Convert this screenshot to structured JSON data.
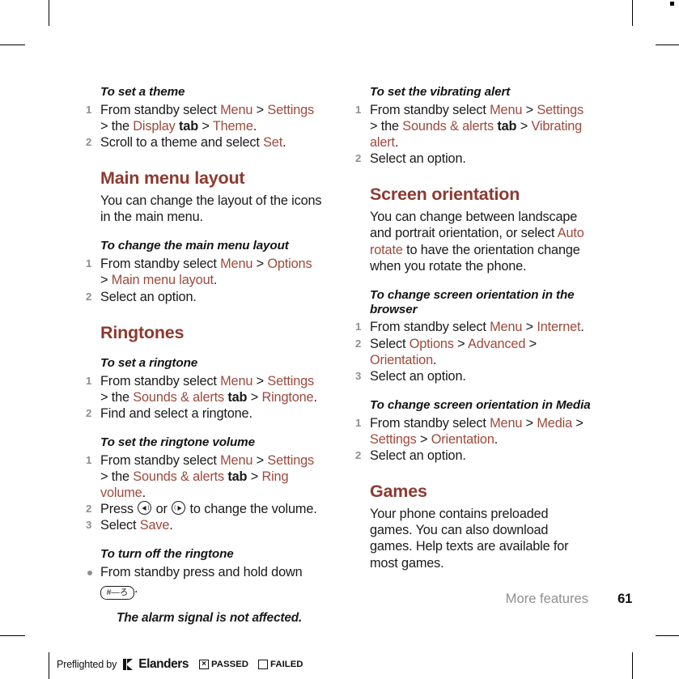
{
  "document": {
    "footer": {
      "section_name": "More features",
      "page_number": "61"
    },
    "preflight": {
      "label": "Preflighted by",
      "brand": "Elanders",
      "passed_label": "PASSED",
      "failed_label": "FAILED",
      "passed_checked": true,
      "failed_checked": false
    },
    "colors": {
      "heading": "#8c3a30",
      "link": "#9b4a3c",
      "body": "#1a1a1a",
      "muted": "#8e8e8e"
    }
  },
  "left_column": {
    "proc_theme": {
      "heading": "To set a theme",
      "steps": [
        {
          "num": "1",
          "parts": [
            {
              "t": "From standby select ",
              "k": "plain"
            },
            {
              "t": "Menu",
              "k": "link"
            },
            {
              "t": " > ",
              "k": "plain"
            },
            {
              "t": "Settings",
              "k": "link"
            },
            {
              "t": " > the ",
              "k": "plain"
            },
            {
              "t": "Display",
              "k": "link"
            },
            {
              "t": " tab",
              "k": "bold"
            },
            {
              "t": " > ",
              "k": "plain"
            },
            {
              "t": "Theme",
              "k": "link"
            },
            {
              "t": ".",
              "k": "plain"
            }
          ]
        },
        {
          "num": "2",
          "parts": [
            {
              "t": "Scroll to a theme and select ",
              "k": "plain"
            },
            {
              "t": "Set",
              "k": "link"
            },
            {
              "t": ".",
              "k": "plain"
            }
          ]
        }
      ]
    },
    "sec_main_menu_layout": {
      "title": "Main menu layout",
      "body": "You can change the layout of the icons in the main menu."
    },
    "proc_change_layout": {
      "heading": "To change the main menu layout",
      "steps": [
        {
          "num": "1",
          "parts": [
            {
              "t": "From standby select ",
              "k": "plain"
            },
            {
              "t": "Menu",
              "k": "link"
            },
            {
              "t": " > ",
              "k": "plain"
            },
            {
              "t": "Options",
              "k": "link"
            },
            {
              "t": " > ",
              "k": "plain"
            },
            {
              "t": "Main menu layout",
              "k": "link"
            },
            {
              "t": ".",
              "k": "plain"
            }
          ]
        },
        {
          "num": "2",
          "parts": [
            {
              "t": "Select an option.",
              "k": "plain"
            }
          ]
        }
      ]
    },
    "sec_ringtones": {
      "title": "Ringtones"
    },
    "proc_set_ringtone": {
      "heading": "To set a ringtone",
      "steps": [
        {
          "num": "1",
          "parts": [
            {
              "t": "From standby select ",
              "k": "plain"
            },
            {
              "t": "Menu",
              "k": "link"
            },
            {
              "t": " > ",
              "k": "plain"
            },
            {
              "t": "Settings",
              "k": "link"
            },
            {
              "t": " > the ",
              "k": "plain"
            },
            {
              "t": "Sounds & alerts",
              "k": "link"
            },
            {
              "t": " tab",
              "k": "bold"
            },
            {
              "t": " > ",
              "k": "plain"
            },
            {
              "t": "Ringtone",
              "k": "link"
            },
            {
              "t": ".",
              "k": "plain"
            }
          ]
        },
        {
          "num": "2",
          "parts": [
            {
              "t": "Find and select a ringtone.",
              "k": "plain"
            }
          ]
        }
      ]
    },
    "proc_ringtone_volume": {
      "heading": "To set the ringtone volume",
      "steps": [
        {
          "num": "1",
          "parts": [
            {
              "t": "From standby select ",
              "k": "plain"
            },
            {
              "t": "Menu",
              "k": "link"
            },
            {
              "t": " > ",
              "k": "plain"
            },
            {
              "t": "Settings",
              "k": "link"
            },
            {
              "t": " > the ",
              "k": "plain"
            },
            {
              "t": "Sounds & alerts",
              "k": "link"
            },
            {
              "t": " tab",
              "k": "bold"
            },
            {
              "t": " > ",
              "k": "plain"
            },
            {
              "t": "Ring volume",
              "k": "link"
            },
            {
              "t": ".",
              "k": "plain"
            }
          ]
        },
        {
          "num": "2",
          "press_prefix": "Press ",
          "press_middle": " or ",
          "press_suffix": " to change the volume.",
          "key_left_name": "volume-down-key",
          "key_right_name": "volume-up-key"
        },
        {
          "num": "3",
          "parts": [
            {
              "t": "Select ",
              "k": "plain"
            },
            {
              "t": "Save",
              "k": "link"
            },
            {
              "t": ".",
              "k": "plain"
            }
          ]
        }
      ]
    },
    "proc_turn_off_ringtone": {
      "heading": "To turn off the ringtone",
      "bullet_text": "From standby press and hold down ",
      "key_hash_label": "#—ろ",
      "bullet_suffix": "."
    },
    "note": {
      "text": "The alarm signal is not affected."
    }
  },
  "right_column": {
    "proc_vibrating_alert": {
      "heading": "To set the vibrating alert",
      "steps": [
        {
          "num": "1",
          "parts": [
            {
              "t": "From standby select ",
              "k": "plain"
            },
            {
              "t": "Menu",
              "k": "link"
            },
            {
              "t": " > ",
              "k": "plain"
            },
            {
              "t": "Settings",
              "k": "link"
            },
            {
              "t": " > the ",
              "k": "plain"
            },
            {
              "t": "Sounds & alerts",
              "k": "link"
            },
            {
              "t": " tab",
              "k": "bold"
            },
            {
              "t": " > ",
              "k": "plain"
            },
            {
              "t": "Vibrating alert",
              "k": "link"
            },
            {
              "t": ".",
              "k": "plain"
            }
          ]
        },
        {
          "num": "2",
          "parts": [
            {
              "t": "Select an option.",
              "k": "plain"
            }
          ]
        }
      ]
    },
    "sec_screen_orientation": {
      "title": "Screen orientation",
      "body_parts": [
        {
          "t": "You can change between landscape and portrait orientation, or select ",
          "k": "plain"
        },
        {
          "t": "Auto rotate",
          "k": "link"
        },
        {
          "t": " to have the orientation change when you rotate the phone.",
          "k": "plain"
        }
      ]
    },
    "proc_orientation_browser": {
      "heading": "To change screen orientation in the browser",
      "steps": [
        {
          "num": "1",
          "parts": [
            {
              "t": "From standby select ",
              "k": "plain"
            },
            {
              "t": "Menu",
              "k": "link"
            },
            {
              "t": " > ",
              "k": "plain"
            },
            {
              "t": "Internet",
              "k": "link"
            },
            {
              "t": ".",
              "k": "plain"
            }
          ]
        },
        {
          "num": "2",
          "parts": [
            {
              "t": "Select ",
              "k": "plain"
            },
            {
              "t": "Options",
              "k": "link"
            },
            {
              "t": " > ",
              "k": "plain"
            },
            {
              "t": "Advanced",
              "k": "link"
            },
            {
              "t": " > ",
              "k": "plain"
            },
            {
              "t": "Orientation",
              "k": "link"
            },
            {
              "t": ".",
              "k": "plain"
            }
          ]
        },
        {
          "num": "3",
          "parts": [
            {
              "t": "Select an option.",
              "k": "plain"
            }
          ]
        }
      ]
    },
    "proc_orientation_media": {
      "heading": "To change screen orientation in Media",
      "steps": [
        {
          "num": "1",
          "parts": [
            {
              "t": "From standby select ",
              "k": "plain"
            },
            {
              "t": "Menu",
              "k": "link"
            },
            {
              "t": " > ",
              "k": "plain"
            },
            {
              "t": "Media",
              "k": "link"
            },
            {
              "t": " > ",
              "k": "plain"
            },
            {
              "t": "Settings",
              "k": "link"
            },
            {
              "t": " > ",
              "k": "plain"
            },
            {
              "t": "Orientation",
              "k": "link"
            },
            {
              "t": ".",
              "k": "plain"
            }
          ]
        },
        {
          "num": "2",
          "parts": [
            {
              "t": "Select an option.",
              "k": "plain"
            }
          ]
        }
      ]
    },
    "sec_games": {
      "title": "Games",
      "body": "Your phone contains preloaded games. You can also download games. Help texts are available for most games."
    }
  }
}
